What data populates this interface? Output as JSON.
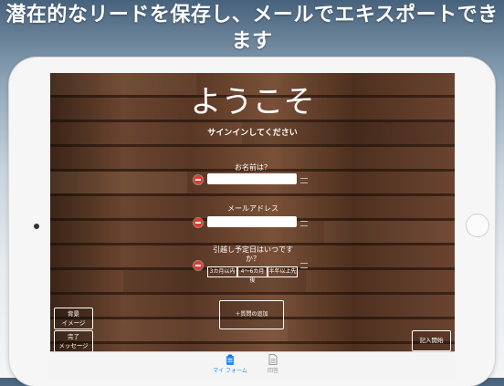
{
  "headline": "潜在的なリードを保存し、メールでエキスポートできます",
  "screen": {
    "title": "ようこそ",
    "subtitle": "サインインしてください",
    "fields": [
      {
        "label": "お名前は？",
        "value": ""
      },
      {
        "label": "メールアドレス",
        "value": ""
      }
    ],
    "move_question": {
      "label": "引越し予定日はいつです\nか？",
      "options": [
        "3カ月以内",
        "4〜6カ月後",
        "半年以上先"
      ]
    },
    "add_question_button": "＋質問の追加",
    "background_image_button": "背景\nイメージ",
    "finish_message_button": "完了\nメッセージ",
    "start_entry_button": "記入開始"
  },
  "tabbar": {
    "tabs": [
      {
        "label": "マイ フォーム",
        "icon": "clipboard-icon",
        "active": true
      },
      {
        "label": "回答",
        "icon": "document-icon",
        "active": false
      }
    ],
    "active_color": "#2a8af6",
    "inactive_color": "#9a9a9a"
  }
}
